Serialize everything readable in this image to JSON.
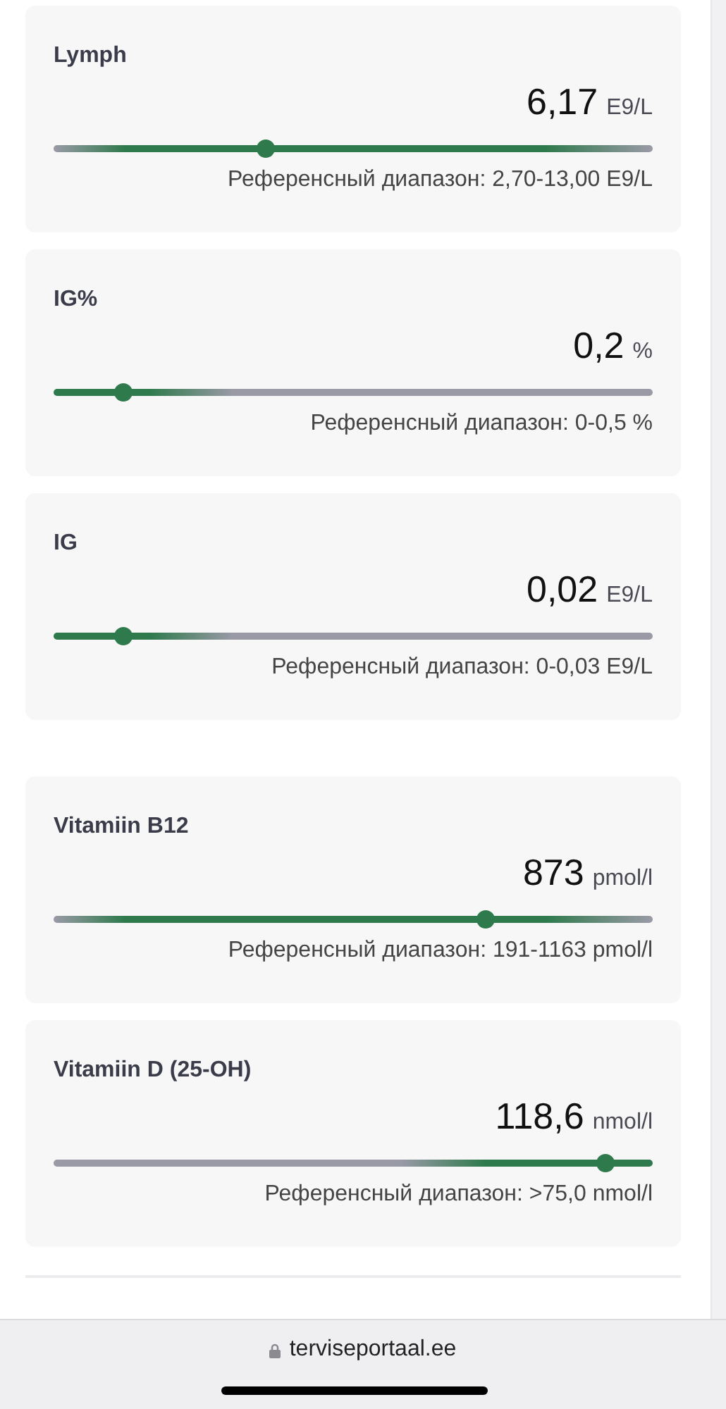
{
  "sections": [
    {
      "results": [
        {
          "name": "Lymph",
          "value": "6,17",
          "unit": "E9/L",
          "level": 0.354,
          "kind": "between",
          "reference": "Референсный диапазон: 2,70-13,00 E9/L"
        },
        {
          "name": "IG%",
          "value": "0,2",
          "unit": "%",
          "level": 0.115,
          "kind": "upper",
          "reference": "Референсный диапазон: 0-0,5 %"
        },
        {
          "name": "IG",
          "value": "0,02",
          "unit": "E9/L",
          "level": 0.115,
          "kind": "upper",
          "reference": "Референсный диапазон: 0-0,03 E9/L"
        }
      ]
    },
    {
      "results": [
        {
          "name": "Vitamiin B12",
          "value": "873",
          "unit": "pmol/l",
          "level": 0.72,
          "kind": "between",
          "reference": "Референсный диапазон: 191-1163 pmol/l"
        },
        {
          "name": "Vitamiin D (25-OH)",
          "value": "118,6",
          "unit": "nmol/l",
          "level": 0.92,
          "kind": "lower",
          "reference": "Референсный диапазон: >75,0 nmol/l"
        }
      ]
    }
  ],
  "address_bar": {
    "url": "terviseportaal.ee"
  }
}
